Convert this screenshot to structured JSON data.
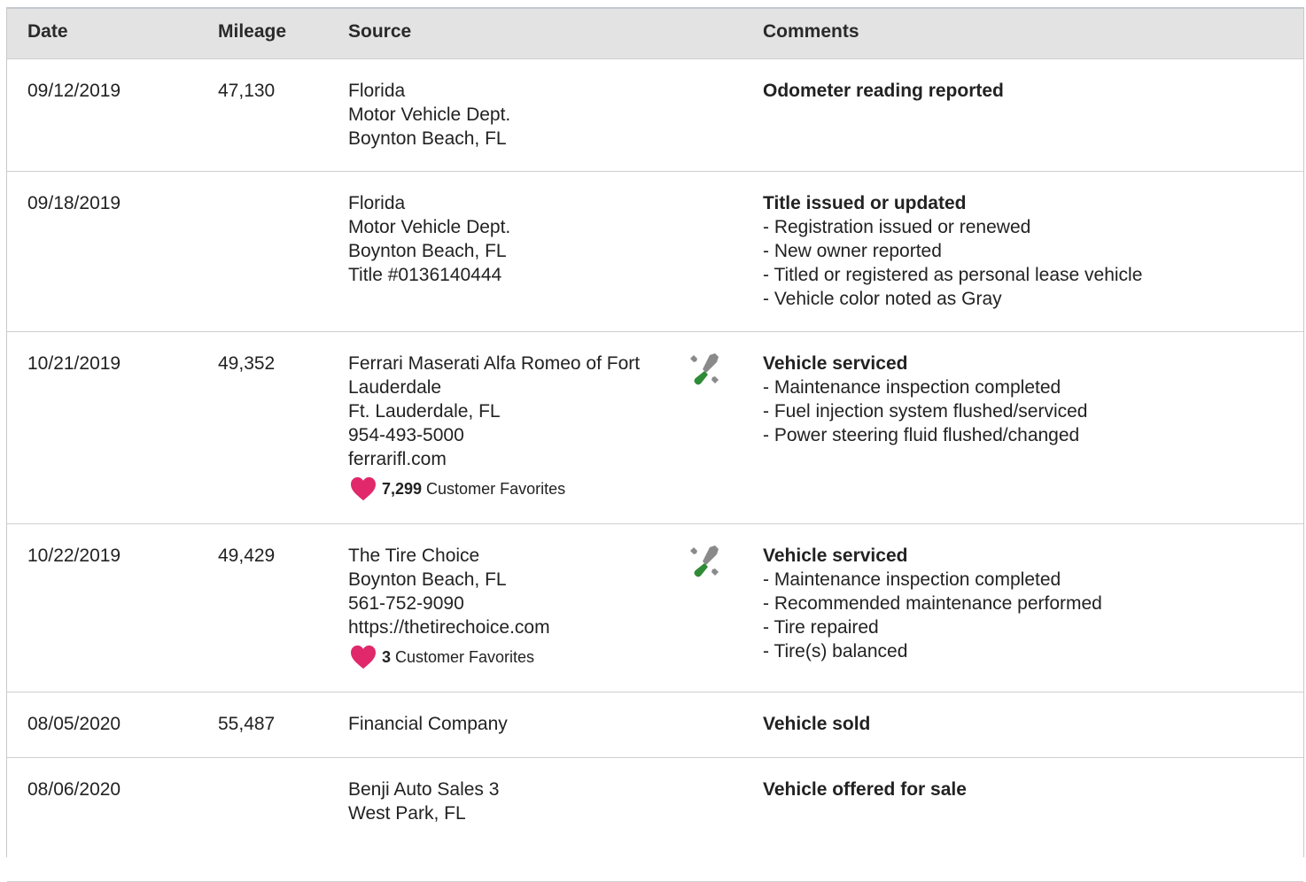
{
  "headers": {
    "date": "Date",
    "mileage": "Mileage",
    "source": "Source",
    "comments": "Comments"
  },
  "colors": {
    "header_bg": "#e3e3e3",
    "heart": "#e0286a",
    "wrench": "#8a8a8a",
    "screwdriver": "#2e8b36"
  },
  "icons": {
    "service": "wrench-screwdriver-icon",
    "favorite": "heart-icon"
  },
  "rows": [
    {
      "date": "09/12/2019",
      "mileage": "47,130",
      "source": [
        "Florida",
        "Motor Vehicle Dept.",
        "Boynton Beach, FL"
      ],
      "comment_head": "Odometer reading reported",
      "comment_items": []
    },
    {
      "date": "09/18/2019",
      "mileage": "",
      "source": [
        "Florida",
        "Motor Vehicle Dept.",
        "Boynton Beach, FL",
        "Title #0136140444"
      ],
      "comment_head": "Title issued or updated",
      "comment_items": [
        "Registration issued or renewed",
        "New owner reported",
        "Titled or registered as personal lease vehicle",
        "Vehicle color noted as Gray"
      ]
    },
    {
      "date": "10/21/2019",
      "mileage": "49,352",
      "source": [
        "Ferrari Maserati Alfa Romeo of Fort",
        "Lauderdale",
        "Ft. Lauderdale, FL",
        "954-493-5000",
        "ferrarifl.com"
      ],
      "favorites_count": "7,299",
      "favorites_label": "Customer Favorites",
      "comment_head": "Vehicle serviced",
      "comment_items": [
        "Maintenance inspection completed",
        "Fuel injection system flushed/serviced",
        "Power steering fluid flushed/changed"
      ]
    },
    {
      "date": "10/22/2019",
      "mileage": "49,429",
      "source": [
        "The Tire Choice",
        "Boynton Beach, FL",
        "561-752-9090",
        "https://thetirechoice.com"
      ],
      "favorites_count": "3",
      "favorites_label": "Customer Favorites",
      "comment_head": "Vehicle serviced",
      "comment_items": [
        "Maintenance inspection completed",
        "Recommended maintenance performed",
        "Tire repaired",
        "Tire(s) balanced"
      ]
    },
    {
      "date": "08/05/2020",
      "mileage": "55,487",
      "source": [
        "Financial Company"
      ],
      "comment_head": "Vehicle sold",
      "comment_items": []
    },
    {
      "date": "08/06/2020",
      "mileage": "",
      "source": [
        "Benji Auto Sales 3",
        "West Park, FL"
      ],
      "comment_head": "Vehicle offered for sale",
      "comment_items": []
    }
  ]
}
